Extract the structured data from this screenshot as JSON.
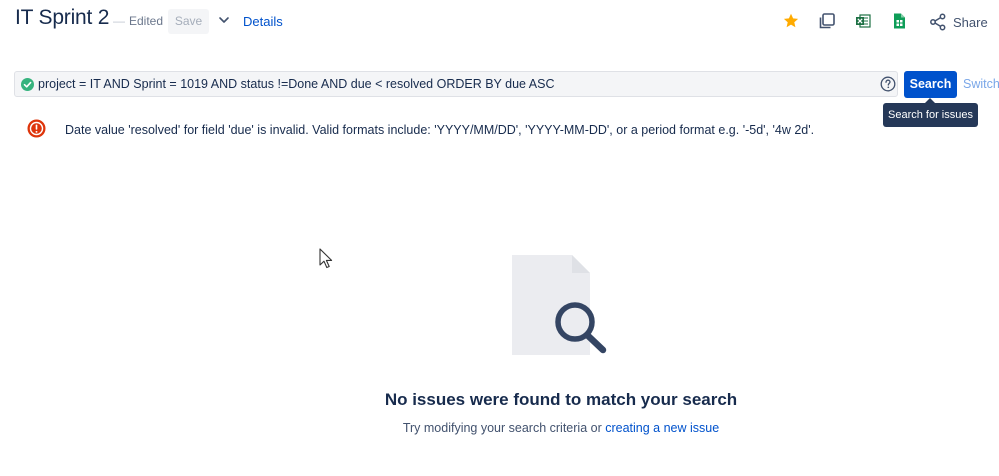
{
  "header": {
    "title": "IT Sprint 2",
    "edited": "Edited",
    "save_label": "Save",
    "details_label": "Details",
    "share_label": "Share",
    "icons": [
      "star-icon",
      "copy-icon",
      "excel-export-icon",
      "sheets-export-icon",
      "share-icon"
    ]
  },
  "search": {
    "jql": "project = IT AND Sprint = 1019 AND status !=Done AND due < resolved ORDER BY due ASC",
    "button_label": "Search",
    "switch_label": "Switch",
    "tooltip": "Search for issues"
  },
  "error": {
    "message": "Date value 'resolved' for field 'due' is invalid. Valid formats include: 'YYYY/MM/DD', 'YYYY-MM-DD', or a period format e.g. '-5d', '4w 2d'."
  },
  "empty_state": {
    "title": "No issues were found to match your search",
    "subtitle_prefix": "Try modifying your search criteria or",
    "create_link": "creating a new issue"
  },
  "colors": {
    "primary": "#0052cc",
    "star": "#ffab00",
    "success": "#36b37e",
    "error": "#de350b",
    "excel": "#1d7044",
    "sheets": "#0f9d58"
  }
}
